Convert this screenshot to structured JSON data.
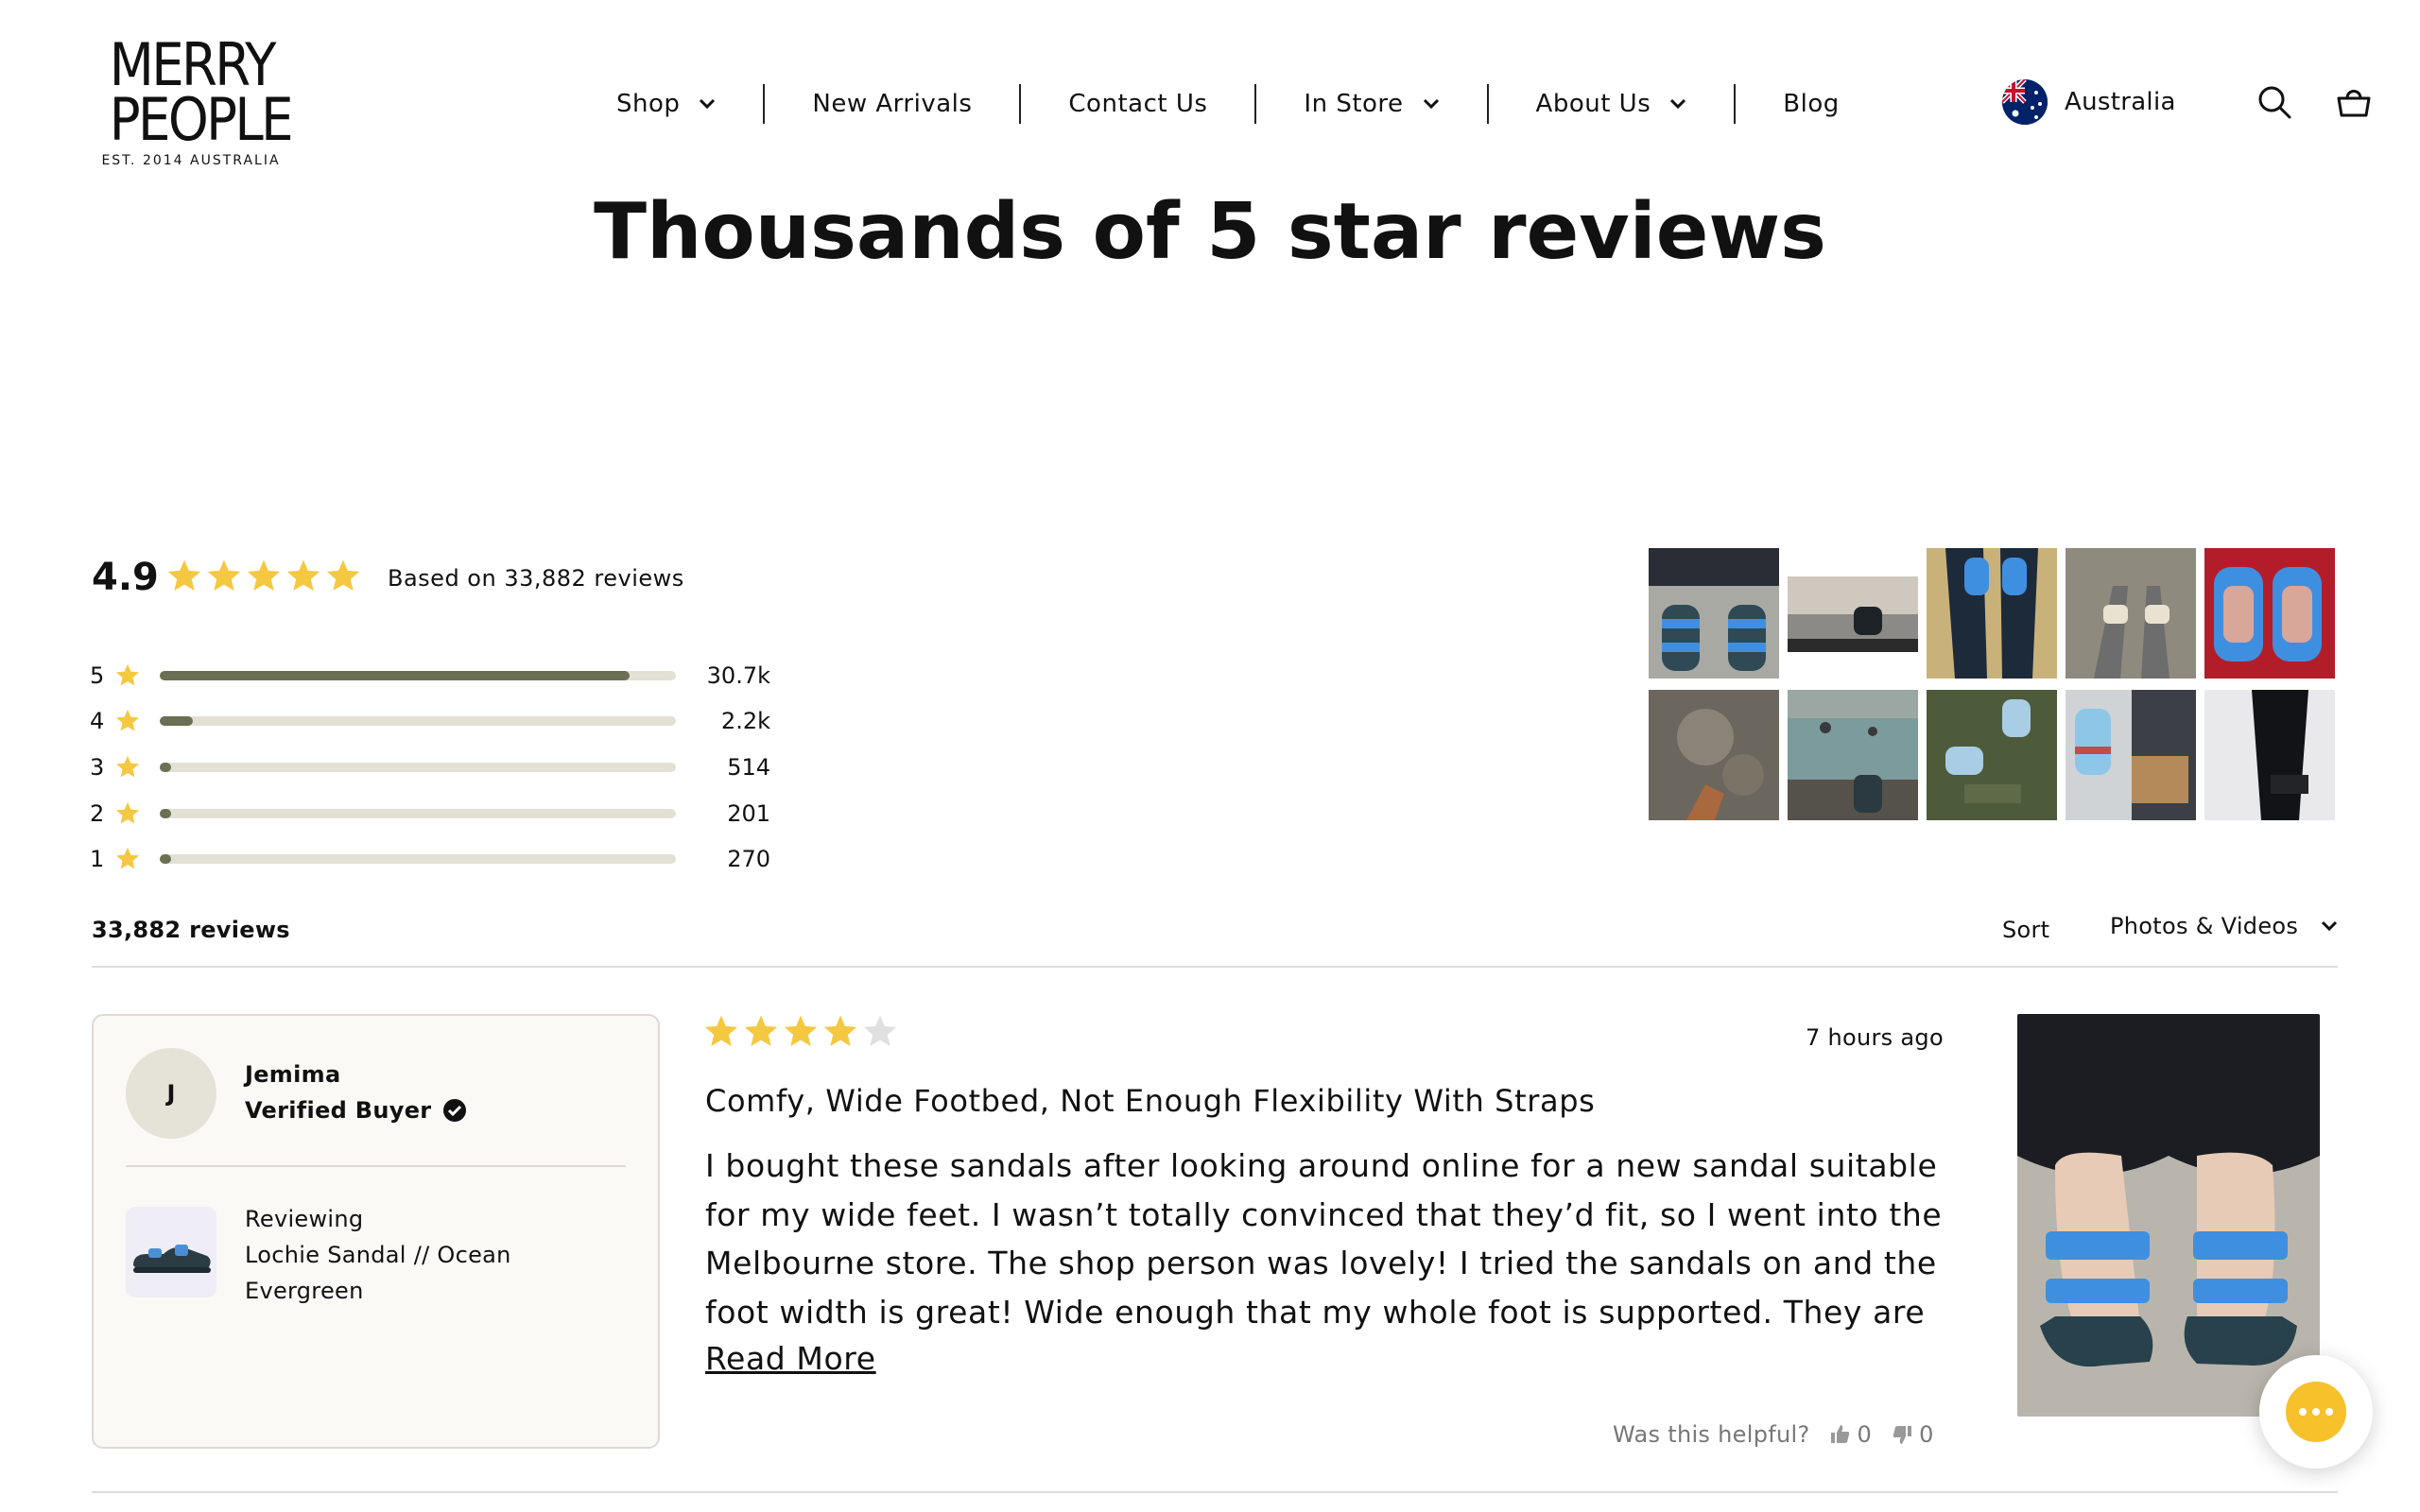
{
  "brand": {
    "logo_line1": "MERRY",
    "logo_line2": "PEOPLE",
    "logo_tagline": "EST. 2014 AUSTRALIA"
  },
  "nav": {
    "items": [
      {
        "label": "Shop",
        "has_dropdown": true
      },
      {
        "label": "New Arrivals",
        "has_dropdown": false
      },
      {
        "label": "Contact Us",
        "has_dropdown": false
      },
      {
        "label": "In Store",
        "has_dropdown": true
      },
      {
        "label": "About Us",
        "has_dropdown": true
      },
      {
        "label": "Blog",
        "has_dropdown": false
      }
    ]
  },
  "header": {
    "region_label": "Australia",
    "region_icon": "australia-flag-icon",
    "search_icon": "search-icon",
    "cart_icon": "cart-basket-icon"
  },
  "page": {
    "title": "Thousands of 5 star reviews"
  },
  "summary": {
    "average": "4.9",
    "average_stars": 5,
    "based_on": "Based on 33,882 reviews",
    "histogram": [
      {
        "stars": "5",
        "count": "30.7k",
        "fraction": 0.91
      },
      {
        "stars": "4",
        "count": "2.2k",
        "fraction": 0.065
      },
      {
        "stars": "3",
        "count": "514",
        "fraction": 0.015
      },
      {
        "stars": "2",
        "count": "201",
        "fraction": 0.006
      },
      {
        "stars": "1",
        "count": "270",
        "fraction": 0.008
      }
    ],
    "gallery_count": 10
  },
  "list": {
    "total_label": "33,882 reviews",
    "sort_label": "Sort",
    "sort_value": "Photos & Videos"
  },
  "review": {
    "author_initial": "J",
    "author_name": "Jemima",
    "verified_label": "Verified Buyer",
    "reviewing_label": "Reviewing",
    "product_name": "Lochie Sandal // Ocean Evergreen",
    "rating": 4,
    "time_ago": "7 hours ago",
    "title": "Comfy, Wide Footbed, Not Enough Flexibility With Straps",
    "body": "I bought these sandals after looking around online for a new sandal suitable for my wide feet. I wasn’t totally convinced that they’d fit, so I went into the Melbourne store. The shop person was lovely! I tried the sandals on and the foot width is great! Wide enough that my whole foot is supported. They are comfy and",
    "read_more": "Read More",
    "helpful_label": "Was this helpful?",
    "helpful_yes": "0",
    "helpful_no": "0"
  },
  "colors": {
    "star": "#f5c842",
    "star_empty": "#e0e0e0",
    "bar_fill": "#6b7055",
    "bar_track": "#e3e1d5",
    "chat": "#f7c12b"
  }
}
